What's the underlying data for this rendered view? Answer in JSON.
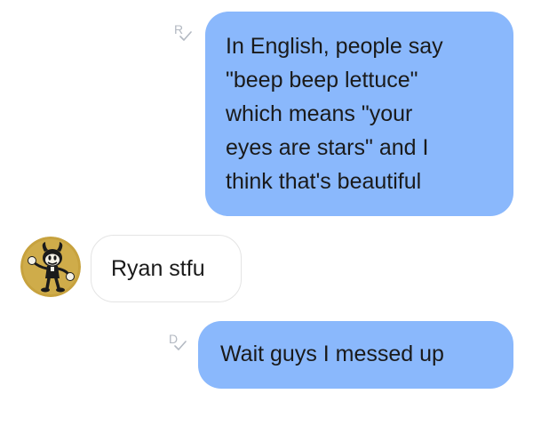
{
  "conversation": {
    "messages": [
      {
        "direction": "outgoing",
        "lines": [
          "In English, people say",
          "\"beep beep lettuce\"",
          "which means \"your",
          "eyes are stars\" and I",
          "think that's beautiful"
        ],
        "receipt_letter": "R"
      },
      {
        "direction": "incoming",
        "text": "Ryan stfu"
      },
      {
        "direction": "outgoing",
        "text": "Wait guys I messed up",
        "receipt_letter": "D"
      }
    ]
  },
  "colors": {
    "outgoing_bubble": "#8ab8fc",
    "incoming_bubble": "#ffffff",
    "incoming_border": "#e4e4e4",
    "receipt_gray": "#b3b9c2",
    "avatar_background": "#c7a23e"
  },
  "icons": {
    "avatar": "cartoon-character-avatar",
    "receipt": "check-mark-icon"
  }
}
